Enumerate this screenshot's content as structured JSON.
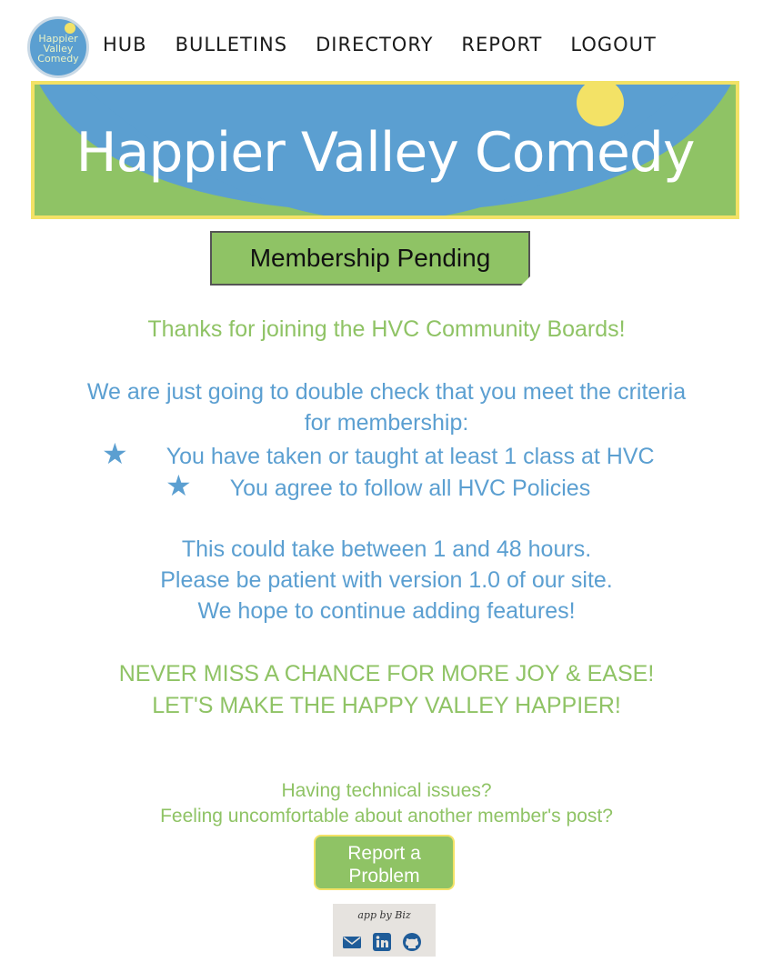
{
  "nav": {
    "logo_text": "Happier Valley Comedy",
    "links": [
      "HUB",
      "BULLETINS",
      "DIRECTORY",
      "REPORT",
      "LOGOUT"
    ]
  },
  "banner": {
    "title": "Happier Valley Comedy"
  },
  "status_label": "Membership Pending",
  "message": {
    "thanks": "Thanks for joining the HVC Community Boards!",
    "check_line1": "We are just going to double check that you meet the criteria",
    "check_line2": "for membership:",
    "criteria": [
      "You have taken or taught at least 1 class at HVC",
      "You agree to follow all HVC Policies"
    ],
    "wait_lines": [
      "This could take between 1 and 48 hours.",
      "Please be patient with version 1.0 of our site.",
      "We hope to continue adding features!"
    ],
    "slogan_lines": [
      "NEVER MISS A CHANCE FOR MORE JOY & EASE!",
      "LET'S MAKE THE HAPPY VALLEY HAPPIER!"
    ]
  },
  "help": {
    "line1": "Having technical issues?",
    "line2": "Feeling uncomfortable about another member's post?",
    "report_button": "Report a Problem"
  },
  "credit": {
    "text": "app by Biz",
    "icons": [
      "envelope-icon",
      "linkedin-icon",
      "github-icon"
    ]
  },
  "colors": {
    "green": "#8fc365",
    "blue": "#5b9fd1",
    "yellow": "#f3e266"
  }
}
